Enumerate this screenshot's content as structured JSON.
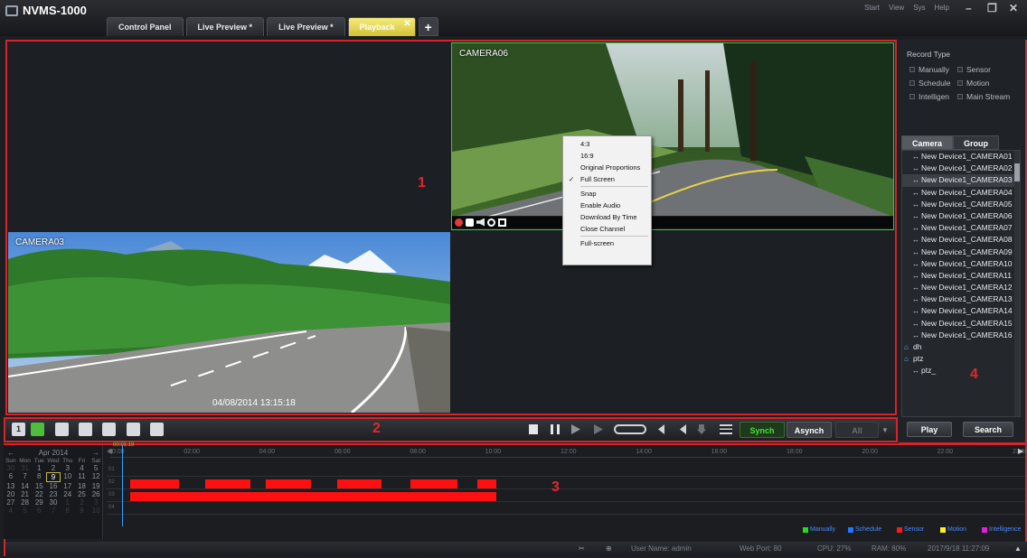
{
  "app": {
    "title": "NVMS-1000"
  },
  "menu": [
    "Start",
    "View",
    "Sys",
    "Help"
  ],
  "window_controls": {
    "minimize": "–",
    "restore": "❐",
    "close": "✕"
  },
  "tabs": [
    {
      "label": "Control Panel"
    },
    {
      "label": "Live Preview *"
    },
    {
      "label": "Live Preview *"
    },
    {
      "label": "Playback",
      "close": "✕"
    }
  ],
  "add_tab": "+",
  "views": {
    "top_right_label": "CAMERA06",
    "bottom_left_label": "CAMERA03",
    "timestamp": "04/08/2014  13:15:18"
  },
  "context_menu": {
    "items": [
      "4:3",
      "16:9",
      "Original Proportions",
      "Full Screen",
      "Snap",
      "Enable Audio",
      "Download By Time",
      "Close Channel",
      "Full-screen"
    ],
    "checked_mark": "✓"
  },
  "region_numbers": [
    "1",
    "2",
    "3",
    "4"
  ],
  "toolbar": {
    "layout_1": "1",
    "synch": "Synch",
    "asynch": "Asynch",
    "all": "All"
  },
  "record_type": {
    "title": "Record Type",
    "options": [
      "Manually",
      "Sensor",
      "Schedule",
      "Motion",
      "Intelligen",
      "Main Stream"
    ]
  },
  "right_tabs": [
    "Camera",
    "Group"
  ],
  "camera_tree": {
    "cameras": [
      "New Device1_CAMERA01",
      "New Device1_CAMERA02",
      "New Device1_CAMERA03",
      "New Device1_CAMERA04",
      "New Device1_CAMERA05",
      "New Device1_CAMERA06",
      "New Device1_CAMERA07",
      "New Device1_CAMERA08",
      "New Device1_CAMERA09",
      "New Device1_CAMERA10",
      "New Device1_CAMERA11",
      "New Device1_CAMERA12",
      "New Device1_CAMERA13",
      "New Device1_CAMERA14",
      "New Device1_CAMERA15",
      "New Device1_CAMERA16"
    ],
    "selected_index": 2,
    "groups": [
      "dh",
      "ptz"
    ],
    "sub_item": "ptz_"
  },
  "right_buttons": {
    "play": "Play",
    "search": "Search"
  },
  "calendar": {
    "month": "Apr  2014",
    "prev": "←",
    "next": "→",
    "weekdays": [
      "Sun",
      "Mon",
      "Tue",
      "Wed",
      "Thu",
      "Fri",
      "Sat"
    ],
    "weeks": [
      [
        "30",
        "31",
        "1",
        "2",
        "3",
        "4",
        "5"
      ],
      [
        "6",
        "7",
        "8",
        "9",
        "10",
        "11",
        "12"
      ],
      [
        "13",
        "14",
        "15",
        "16",
        "17",
        "18",
        "19"
      ],
      [
        "20",
        "21",
        "22",
        "23",
        "24",
        "25",
        "26"
      ],
      [
        "27",
        "28",
        "29",
        "30",
        "1",
        "2",
        "3"
      ],
      [
        "4",
        "5",
        "6",
        "7",
        "8",
        "9",
        "10"
      ]
    ],
    "today": "9"
  },
  "timeline": {
    "cursor_time": "00:01:19",
    "ticks": [
      "00:00",
      "02:00",
      "04:00",
      "06:00",
      "08:00",
      "10:00",
      "12:00",
      "14:00",
      "16:00",
      "18:00",
      "20:00",
      "22:00",
      "23:59"
    ],
    "lanes": [
      {
        "label": "01",
        "segments": []
      },
      {
        "label": "02",
        "segments": [
          [
            0.3,
            1.6
          ],
          [
            2.3,
            3.5
          ],
          [
            3.9,
            5.1
          ],
          [
            5.8,
            7.0
          ],
          [
            7.75,
            9.0
          ],
          [
            9.55,
            10.05
          ]
        ]
      },
      {
        "label": "03",
        "segments": [
          [
            0.3,
            10.05
          ]
        ]
      },
      {
        "label": "04",
        "segments": []
      }
    ],
    "legend": [
      {
        "label": "Manually",
        "color": "#22dd22"
      },
      {
        "label": "Schedule",
        "color": "#2277ff"
      },
      {
        "label": "Sensor",
        "color": "#ff1a1a"
      },
      {
        "label": "Motion",
        "color": "#ffee22"
      },
      {
        "label": "Intelligence",
        "color": "#dd22dd"
      }
    ]
  },
  "status": {
    "user": "User Name: admin",
    "port": "Web Port: 80",
    "cpu": "CPU: 27%",
    "ram": "RAM: 80%",
    "datetime": "2017/9/18 11:27:09"
  }
}
